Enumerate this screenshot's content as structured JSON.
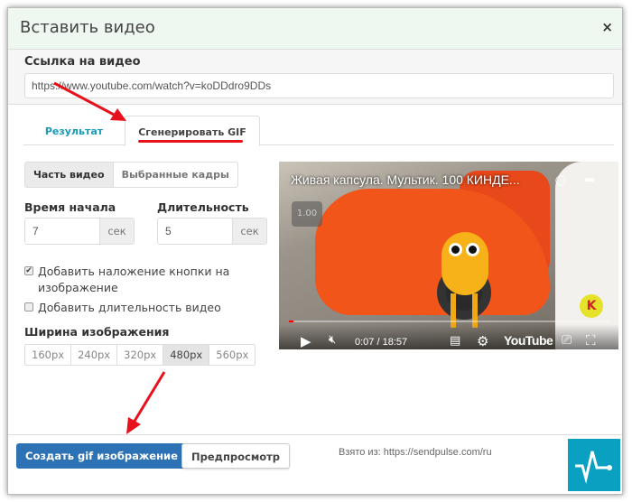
{
  "dialog": {
    "title": "Вставить видео",
    "close": "×"
  },
  "url": {
    "label": "Ссылка на видео",
    "value": "https://www.youtube.com/watch?v=koDDdro9DDs"
  },
  "tabs": [
    {
      "label": "Результат"
    },
    {
      "label": "Сгенерировать GIF",
      "active": true
    }
  ],
  "mode": {
    "options": [
      "Часть видео",
      "Выбранные кадры"
    ],
    "selected": "Часть видео"
  },
  "start": {
    "label": "Время начала",
    "value": "7",
    "unit": "сек"
  },
  "duration": {
    "label": "Длительность",
    "value": "5",
    "unit": "сек"
  },
  "checks": [
    {
      "label": "Добавить наложение кнопки на изображение",
      "checked": true
    },
    {
      "label": "Добавить длительность видео",
      "checked": false
    }
  ],
  "width": {
    "label": "Ширина изображения",
    "options": [
      "160px",
      "240px",
      "320px",
      "480px",
      "560px"
    ],
    "selected": "480px"
  },
  "video": {
    "title": "Живая капсула. Мультик. 100 КИНДЕ...",
    "speed": "1.00",
    "time": "0:07 / 18:57",
    "brand": "YouTube",
    "progress": 0.006,
    "badge": "K"
  },
  "footer": {
    "create": "Создать gif изображение",
    "preview": "Предпросмотр",
    "source": "Взято из: https://sendpulse.com/ru"
  },
  "colors": {
    "accent": "#2e72b6",
    "tab": "#1a9ab4",
    "arrow": "#e8101a",
    "logo": "#09a0c2"
  }
}
